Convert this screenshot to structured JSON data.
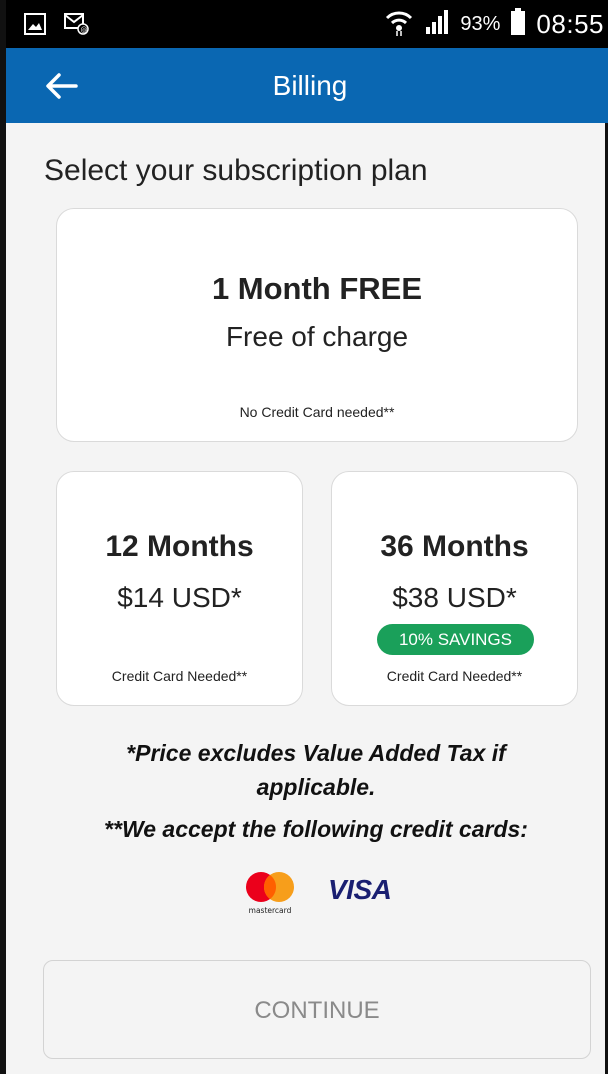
{
  "status_bar": {
    "battery_percent": "93%",
    "time": "08:55",
    "icons": [
      "gallery-icon",
      "email-notification-icon",
      "wifi-icon",
      "signal-icon",
      "battery-icon"
    ]
  },
  "app_bar": {
    "title": "Billing",
    "back_icon": "arrow-left-icon",
    "background": "#0a67b2"
  },
  "heading": "Select your subscription plan",
  "plans": {
    "free": {
      "title": "1 Month FREE",
      "subtitle": "Free of charge",
      "note": "No Credit Card needed**"
    },
    "twelve": {
      "title": "12 Months",
      "price": "$14 USD*",
      "note": "Credit Card Needed**"
    },
    "thirtysix": {
      "title": "36 Months",
      "price": "$38 USD*",
      "badge": "10% SAVINGS",
      "badge_color": "#1aa05a",
      "note": "Credit Card Needed**"
    }
  },
  "footnotes": {
    "tax": "*Price excludes Value Added Tax if applicable.",
    "cards": "**We accept the following credit cards:"
  },
  "accepted_cards": {
    "mastercard_wordmark": "mastercard",
    "visa": "VISA"
  },
  "continue_label": "CONTINUE"
}
